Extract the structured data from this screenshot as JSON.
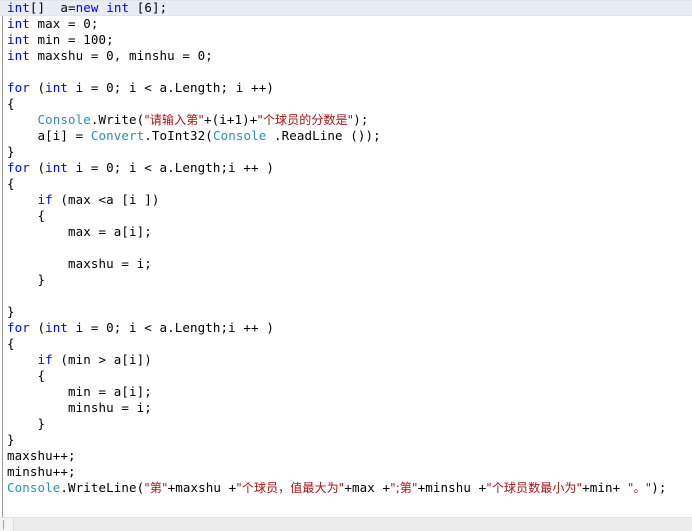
{
  "editor": {
    "language": "csharp",
    "current_line_index": 0,
    "colors": {
      "background": "#ffffff",
      "foreground": "#000000",
      "keyword": "#0000ff",
      "type": "#2b91af",
      "string": "#a31515",
      "current_line_highlight": "#e8ecf5",
      "scrollbar_track": "#ececed",
      "margin_rule": "#9a9a9a"
    },
    "scrollbar": {
      "orientation": "horizontal",
      "present": true
    },
    "lines": [
      {
        "indent": 0,
        "tokens": [
          {
            "t": "int",
            "c": "key"
          },
          {
            "t": "[]  a=",
            "c": "plain"
          },
          {
            "t": "new",
            "c": "key"
          },
          {
            "t": " ",
            "c": "plain"
          },
          {
            "t": "int",
            "c": "key"
          },
          {
            "t": " [6];",
            "c": "plain"
          }
        ]
      },
      {
        "indent": 0,
        "tokens": [
          {
            "t": "int",
            "c": "key"
          },
          {
            "t": " max = 0;",
            "c": "plain"
          }
        ]
      },
      {
        "indent": 0,
        "tokens": [
          {
            "t": "int",
            "c": "key"
          },
          {
            "t": " min = 100;",
            "c": "plain"
          }
        ]
      },
      {
        "indent": 0,
        "tokens": [
          {
            "t": "int",
            "c": "key"
          },
          {
            "t": " maxshu = 0, minshu = 0;",
            "c": "plain"
          }
        ]
      },
      {
        "indent": 0,
        "tokens": []
      },
      {
        "indent": 0,
        "tokens": [
          {
            "t": "for",
            "c": "key"
          },
          {
            "t": " (",
            "c": "plain"
          },
          {
            "t": "int",
            "c": "key"
          },
          {
            "t": " i = 0; i < a.Length; i ++)",
            "c": "plain"
          }
        ]
      },
      {
        "indent": 0,
        "tokens": [
          {
            "t": "{",
            "c": "plain"
          }
        ]
      },
      {
        "indent": 1,
        "tokens": [
          {
            "t": "Console",
            "c": "type"
          },
          {
            "t": ".Write(",
            "c": "plain"
          },
          {
            "t": "\"请输入第\"",
            "c": "str"
          },
          {
            "t": "+(i+1)+",
            "c": "plain"
          },
          {
            "t": "\"个球员的分数是\"",
            "c": "str"
          },
          {
            "t": ");",
            "c": "plain"
          }
        ]
      },
      {
        "indent": 1,
        "tokens": [
          {
            "t": "a[i] = ",
            "c": "plain"
          },
          {
            "t": "Convert",
            "c": "type"
          },
          {
            "t": ".ToInt32(",
            "c": "plain"
          },
          {
            "t": "Console",
            "c": "type"
          },
          {
            "t": " .ReadLine ());",
            "c": "plain"
          }
        ]
      },
      {
        "indent": 0,
        "tokens": [
          {
            "t": "}",
            "c": "plain"
          }
        ]
      },
      {
        "indent": 0,
        "tokens": [
          {
            "t": "for",
            "c": "key"
          },
          {
            "t": " (",
            "c": "plain"
          },
          {
            "t": "int",
            "c": "key"
          },
          {
            "t": " i = 0; i < a.Length;i ++ )",
            "c": "plain"
          }
        ]
      },
      {
        "indent": 0,
        "tokens": [
          {
            "t": "{",
            "c": "plain"
          }
        ]
      },
      {
        "indent": 1,
        "tokens": [
          {
            "t": "if",
            "c": "key"
          },
          {
            "t": " (max <a [i ])",
            "c": "plain"
          }
        ]
      },
      {
        "indent": 1,
        "tokens": [
          {
            "t": "{",
            "c": "plain"
          }
        ]
      },
      {
        "indent": 2,
        "tokens": [
          {
            "t": "max = a[i];",
            "c": "plain"
          }
        ]
      },
      {
        "indent": 0,
        "tokens": []
      },
      {
        "indent": 2,
        "tokens": [
          {
            "t": "maxshu = i;",
            "c": "plain"
          }
        ]
      },
      {
        "indent": 1,
        "tokens": [
          {
            "t": "}",
            "c": "plain"
          }
        ]
      },
      {
        "indent": 0,
        "tokens": []
      },
      {
        "indent": 0,
        "tokens": [
          {
            "t": "}",
            "c": "plain"
          }
        ]
      },
      {
        "indent": 0,
        "tokens": [
          {
            "t": "for",
            "c": "key"
          },
          {
            "t": " (",
            "c": "plain"
          },
          {
            "t": "int",
            "c": "key"
          },
          {
            "t": " i = 0; i < a.Length;i ++ )",
            "c": "plain"
          }
        ]
      },
      {
        "indent": 0,
        "tokens": [
          {
            "t": "{",
            "c": "plain"
          }
        ]
      },
      {
        "indent": 1,
        "tokens": [
          {
            "t": "if",
            "c": "key"
          },
          {
            "t": " (min > a[i])",
            "c": "plain"
          }
        ]
      },
      {
        "indent": 1,
        "tokens": [
          {
            "t": "{",
            "c": "plain"
          }
        ]
      },
      {
        "indent": 2,
        "tokens": [
          {
            "t": "min = a[i];",
            "c": "plain"
          }
        ]
      },
      {
        "indent": 2,
        "tokens": [
          {
            "t": "minshu = i;",
            "c": "plain"
          }
        ]
      },
      {
        "indent": 1,
        "tokens": [
          {
            "t": "}",
            "c": "plain"
          }
        ]
      },
      {
        "indent": 0,
        "tokens": [
          {
            "t": "}",
            "c": "plain"
          }
        ]
      },
      {
        "indent": 0,
        "tokens": [
          {
            "t": "maxshu++;",
            "c": "plain"
          }
        ]
      },
      {
        "indent": 0,
        "tokens": [
          {
            "t": "minshu++;",
            "c": "plain"
          }
        ]
      },
      {
        "indent": 0,
        "tokens": [
          {
            "t": "Console",
            "c": "type"
          },
          {
            "t": ".WriteLine(",
            "c": "plain"
          },
          {
            "t": "\"第\"",
            "c": "str"
          },
          {
            "t": "+maxshu +",
            "c": "plain"
          },
          {
            "t": "\"个球员，值最大为\"",
            "c": "str"
          },
          {
            "t": "+max +",
            "c": "plain"
          },
          {
            "t": "\";第\"",
            "c": "str"
          },
          {
            "t": "+minshu +",
            "c": "plain"
          },
          {
            "t": "\"个球员数最小为\"",
            "c": "str"
          },
          {
            "t": "+min+ ",
            "c": "plain"
          },
          {
            "t": "\"。\"",
            "c": "str"
          },
          {
            "t": ");",
            "c": "plain"
          }
        ]
      }
    ]
  }
}
